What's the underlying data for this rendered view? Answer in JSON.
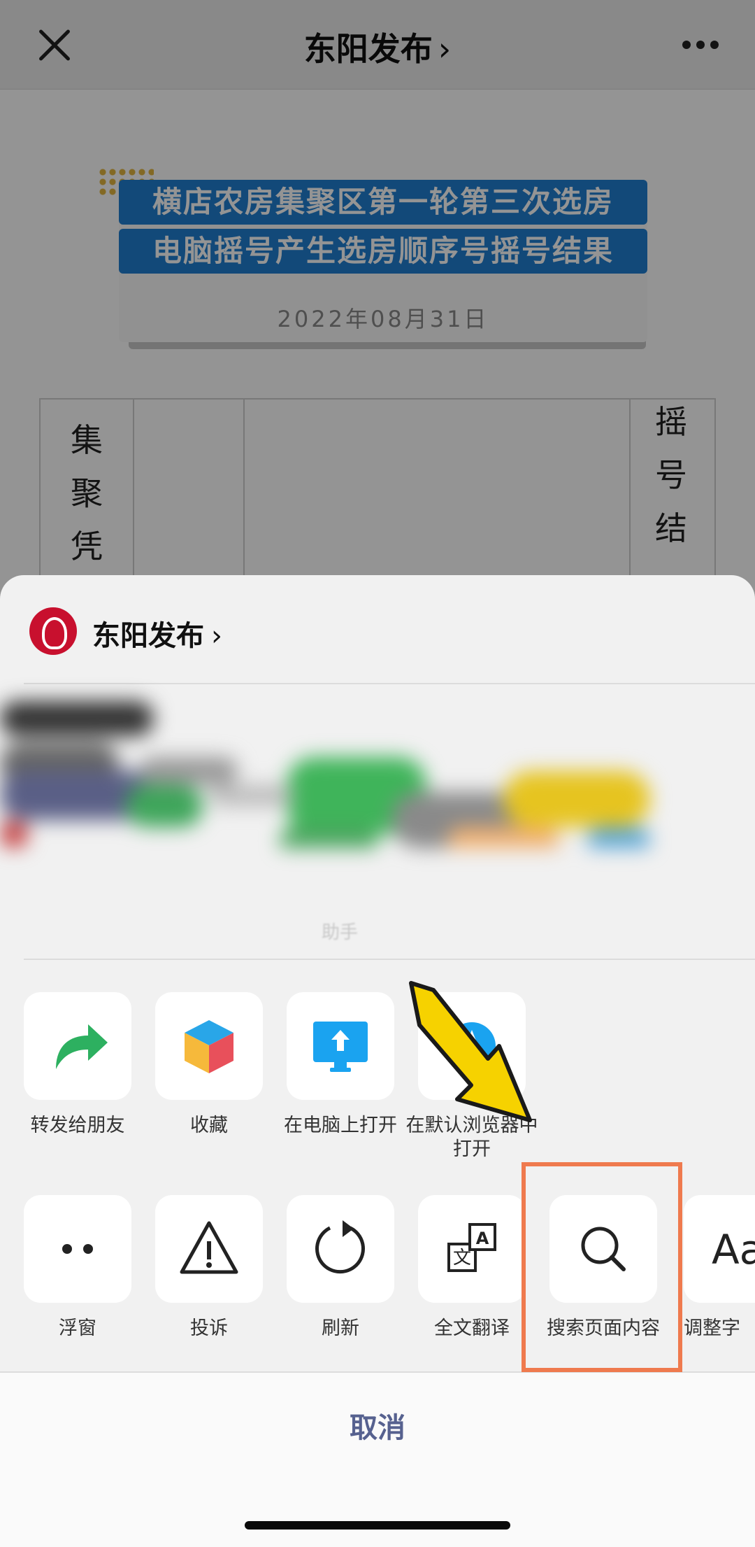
{
  "nav": {
    "title": "东阳发布",
    "title_chevron": "›"
  },
  "article": {
    "banner_line1": "横店农房集聚区第一轮第三次选房",
    "banner_line2": "电脑摇号产生选房顺序号摇号结果",
    "date": "2022年08月31日",
    "table_col1_chars": [
      "集",
      "聚",
      "凭"
    ],
    "table_col4_chars": [
      "摇",
      "号",
      "结"
    ]
  },
  "sheet": {
    "account_name": "东阳发布",
    "account_chevron": "›",
    "preview_label": "助手",
    "row1": [
      {
        "label": "转发给朋友",
        "icon": "share-arrow-icon"
      },
      {
        "label": "收藏",
        "icon": "favorite-cube-icon"
      },
      {
        "label": "在电脑上打开",
        "icon": "computer-upload-icon"
      },
      {
        "label": "在默认浏览器中打开",
        "icon": "browser-compass-icon"
      }
    ],
    "row2": [
      {
        "label": "浮窗",
        "icon": "float-window-icon"
      },
      {
        "label": "投诉",
        "icon": "warning-icon"
      },
      {
        "label": "刷新",
        "icon": "refresh-icon"
      },
      {
        "label": "全文翻译",
        "icon": "translate-icon"
      },
      {
        "label": "搜索页面内容",
        "icon": "search-icon"
      },
      {
        "label": "调整字",
        "icon": "font-size-icon"
      }
    ],
    "font_icon_text": "Aa",
    "translate_glyph_cn": "文",
    "translate_glyph_en": "A",
    "cancel_label": "取消"
  },
  "colors": {
    "banner_blue": "#1f7fd0",
    "share_green": "#2db060",
    "computer_blue": "#1aa3f0",
    "cancel_text": "#56618f",
    "highlight_orange": "#ef7a4e",
    "arrow_yellow": "#f6d200"
  }
}
